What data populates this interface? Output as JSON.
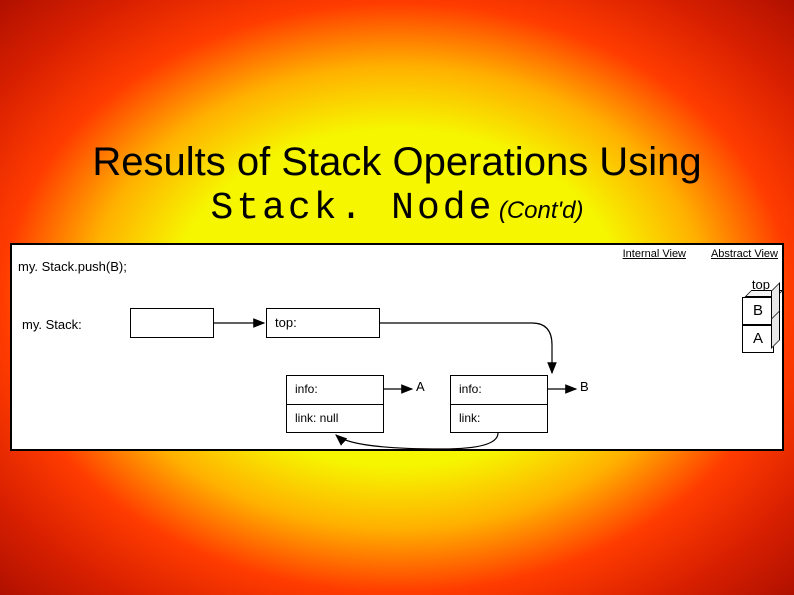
{
  "title": {
    "line1": "Results of Stack Operations Using",
    "mono": "Stack. Node",
    "contd": "(Cont'd)"
  },
  "panel": {
    "internal_view_label": "Internal View",
    "abstract_view_label": "Abstract View",
    "operation": "my. Stack.push(B);",
    "mystack_label": "my. Stack:",
    "top_label": "top:",
    "nodeA": {
      "info_label": "info:",
      "info_value": "A",
      "link_label": "link: null"
    },
    "nodeB": {
      "info_label": "info:",
      "info_value": "B",
      "link_label": "link:"
    },
    "abstract": {
      "top_label": "top",
      "cells": [
        "B",
        "A"
      ]
    }
  }
}
